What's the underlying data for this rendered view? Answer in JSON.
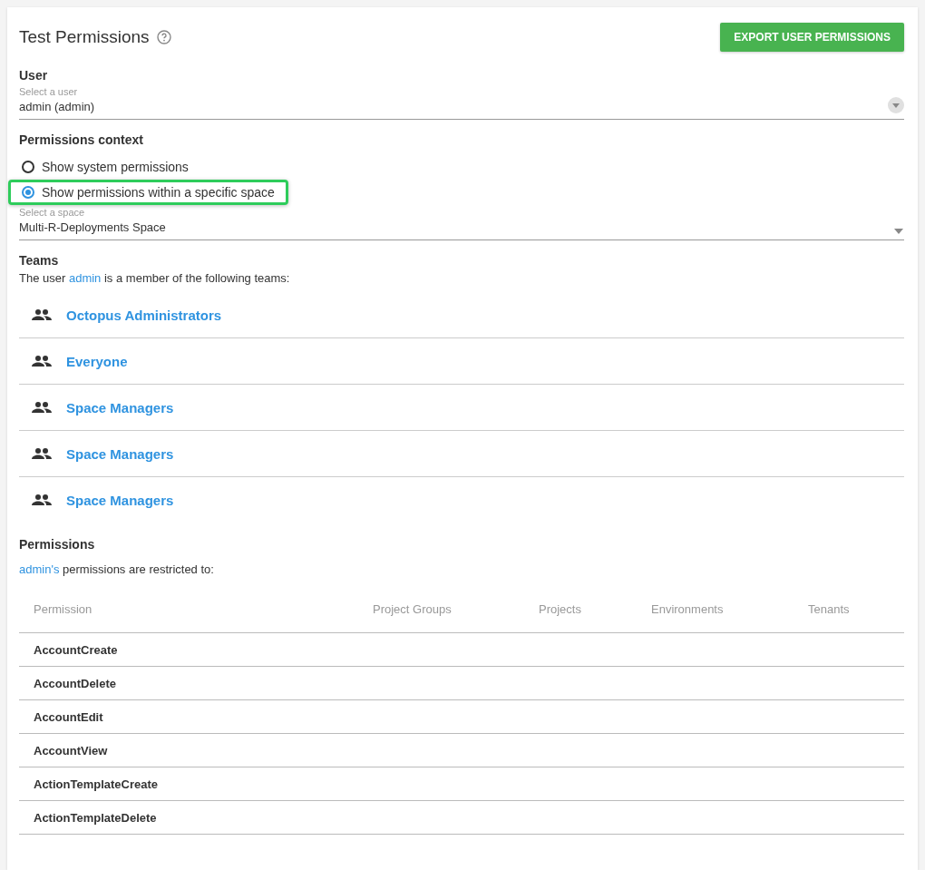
{
  "header": {
    "title": "Test Permissions",
    "export_button": "EXPORT USER PERMISSIONS"
  },
  "user": {
    "heading": "User",
    "label": "Select a user",
    "value": "admin (admin)"
  },
  "context": {
    "heading": "Permissions context",
    "options": [
      {
        "label": "Show system permissions",
        "selected": false,
        "highlighted": false
      },
      {
        "label": "Show permissions within a specific space",
        "selected": true,
        "highlighted": true
      }
    ],
    "space_label": "Select a space",
    "space_value": "Multi-R-Deployments Space"
  },
  "teams": {
    "heading": "Teams",
    "intro_before": "The user",
    "intro_link": "admin",
    "intro_after": "is a member of the following teams:",
    "items": [
      {
        "name": "Octopus Administrators"
      },
      {
        "name": "Everyone"
      },
      {
        "name": "Space Managers"
      },
      {
        "name": "Space Managers"
      },
      {
        "name": "Space Managers"
      }
    ]
  },
  "permissions": {
    "heading": "Permissions",
    "intro_link": "admin's",
    "intro_after": "permissions are restricted to:",
    "columns": [
      "Permission",
      "Project Groups",
      "Projects",
      "Environments",
      "Tenants"
    ],
    "rows": [
      {
        "permission": "AccountCreate"
      },
      {
        "permission": "AccountDelete"
      },
      {
        "permission": "AccountEdit"
      },
      {
        "permission": "AccountView"
      },
      {
        "permission": "ActionTemplateCreate"
      },
      {
        "permission": "ActionTemplateDelete"
      }
    ]
  }
}
